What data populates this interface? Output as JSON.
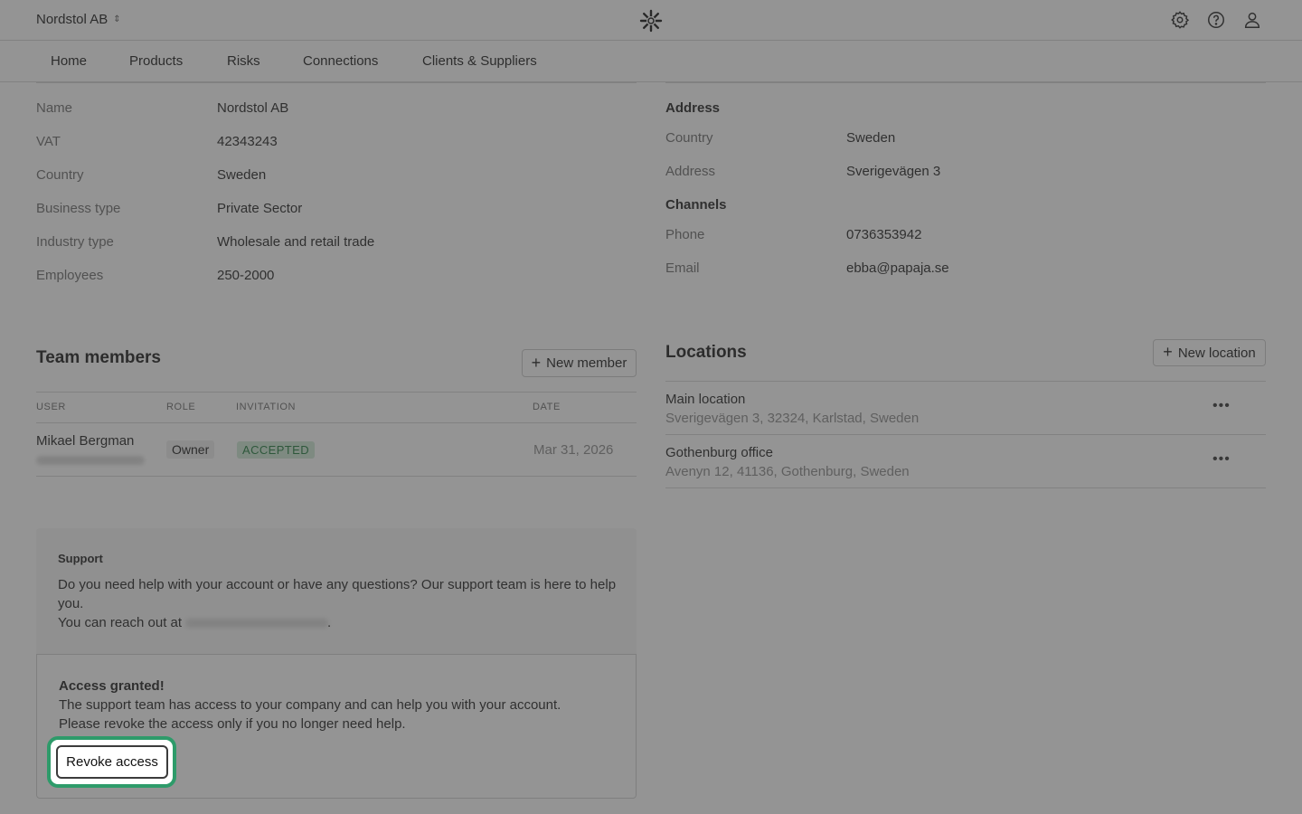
{
  "header": {
    "company": "Nordstol AB",
    "icons": [
      "settings-icon",
      "help-icon",
      "user-icon"
    ]
  },
  "nav": {
    "items": [
      "Home",
      "Products",
      "Risks",
      "Connections",
      "Clients & Suppliers"
    ]
  },
  "company_info": {
    "rows": [
      {
        "label": "Name",
        "value": "Nordstol AB"
      },
      {
        "label": "VAT",
        "value": "42343243"
      },
      {
        "label": "Country",
        "value": "Sweden"
      },
      {
        "label": "Business type",
        "value": "Private Sector"
      },
      {
        "label": "Industry type",
        "value": "Wholesale and retail trade"
      },
      {
        "label": "Employees",
        "value": "250-2000"
      }
    ]
  },
  "address_info": {
    "address_heading": "Address",
    "address_rows": [
      {
        "label": "Country",
        "value": "Sweden"
      },
      {
        "label": "Address",
        "value": "Sverigevägen 3"
      }
    ],
    "channels_heading": "Channels",
    "channel_rows": [
      {
        "label": "Phone",
        "value": "0736353942"
      },
      {
        "label": "Email",
        "value": "ebba@papaja.se"
      }
    ]
  },
  "team": {
    "title": "Team members",
    "new_button": "New member",
    "columns": [
      "USER",
      "ROLE",
      "INVITATION",
      "DATE"
    ],
    "members": [
      {
        "name": "Mikael Bergman",
        "role": "Owner",
        "invitation": "ACCEPTED",
        "date": "Mar 31, 2026"
      }
    ]
  },
  "locations": {
    "title": "Locations",
    "new_button": "New location",
    "items": [
      {
        "name": "Main location",
        "address": "Sverigevägen 3, 32324, Karlstad, Sweden"
      },
      {
        "name": "Gothenburg office",
        "address": "Avenyn 12, 41136, Gothenburg, Sweden"
      }
    ]
  },
  "support": {
    "title": "Support",
    "text_line1": "Do you need help with your account or have any questions? Our support team is here to help",
    "text_line2": "you.",
    "reach_prefix": "You can reach out at",
    "reach_suffix": ".",
    "access_title": "Access granted!",
    "access_line1": "The support team has access to your company and can help you with your account.",
    "access_line2": "Please revoke the access only if you no longer need help.",
    "revoke_button": "Revoke access"
  },
  "colors": {
    "accent_ring": "#2e9b6a",
    "accepted_bg": "#cfe9d6",
    "accepted_text": "#1f7a3d"
  }
}
